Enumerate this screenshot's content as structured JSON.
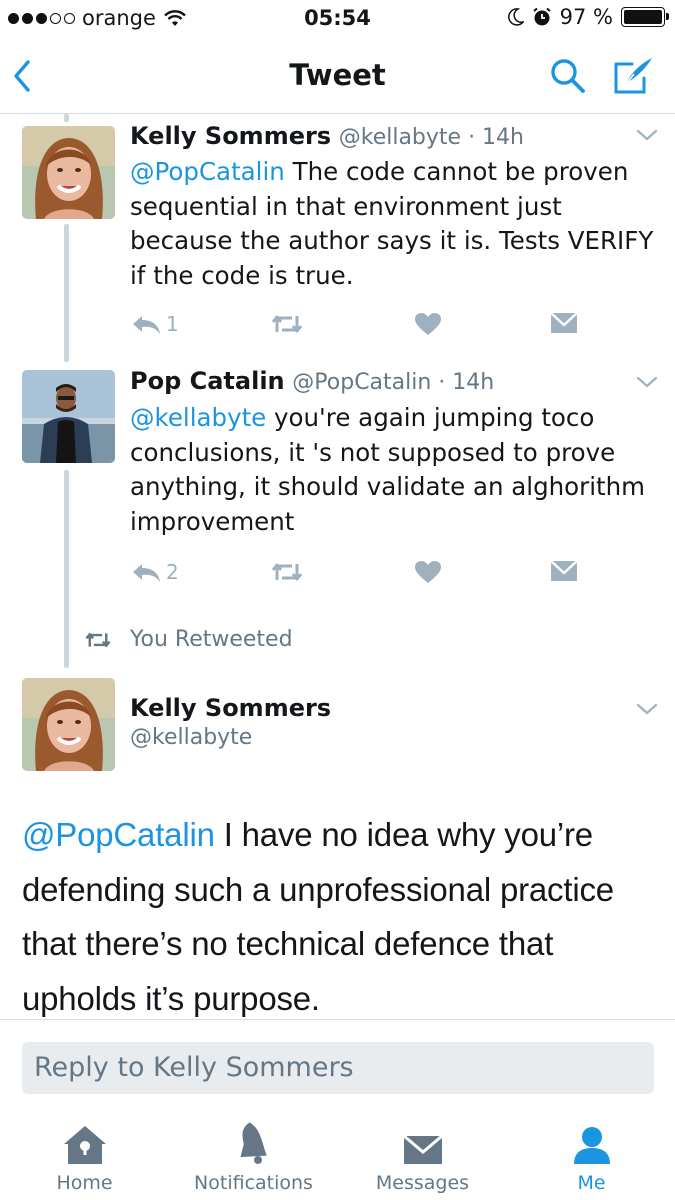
{
  "status_bar": {
    "carrier": "orange",
    "time": "05:54",
    "battery": "97 %",
    "signal_dots_filled": 3,
    "signal_dots_total": 5
  },
  "nav": {
    "title": "Tweet",
    "back_icon": "chevron-left-icon",
    "search_icon": "search-icon",
    "compose_icon": "compose-icon"
  },
  "tweets": [
    {
      "name": "Kelly Sommers",
      "meta": "@kellabyte · 14h",
      "mention": "@PopCatalin",
      "text": " The code cannot be proven sequential in that environment just because the author says it is. Tests VERIFY if the code is true.",
      "reply_count": "1"
    },
    {
      "name": "Pop Catalin",
      "meta": "@PopCatalin · 14h",
      "mention": "@kellabyte",
      "text": " you're again jumping toco conclusions, it 's not supposed to prove anything, it should validate an alghorithm improvement",
      "reply_count": "2"
    }
  ],
  "retweeted_label": "You Retweeted",
  "main_tweet": {
    "name": "Kelly Sommers",
    "handle": "@kellabyte",
    "mention": "@PopCatalin",
    "text": " I have no idea why you’re defending such a unprofessional practice that there’s no technical defence that upholds it’s purpose."
  },
  "reply": {
    "placeholder": "Reply to Kelly Sommers"
  },
  "tabs": [
    {
      "label": "Home",
      "icon": "home-icon"
    },
    {
      "label": "Notifications",
      "icon": "bell-icon"
    },
    {
      "label": "Messages",
      "icon": "envelope-icon"
    },
    {
      "label": "Me",
      "icon": "person-icon"
    }
  ],
  "colors": {
    "accent": "#1b95e0",
    "muted": "#657786",
    "icon_gray": "#9fb1bf",
    "thread_line": "#ccd6dd"
  }
}
